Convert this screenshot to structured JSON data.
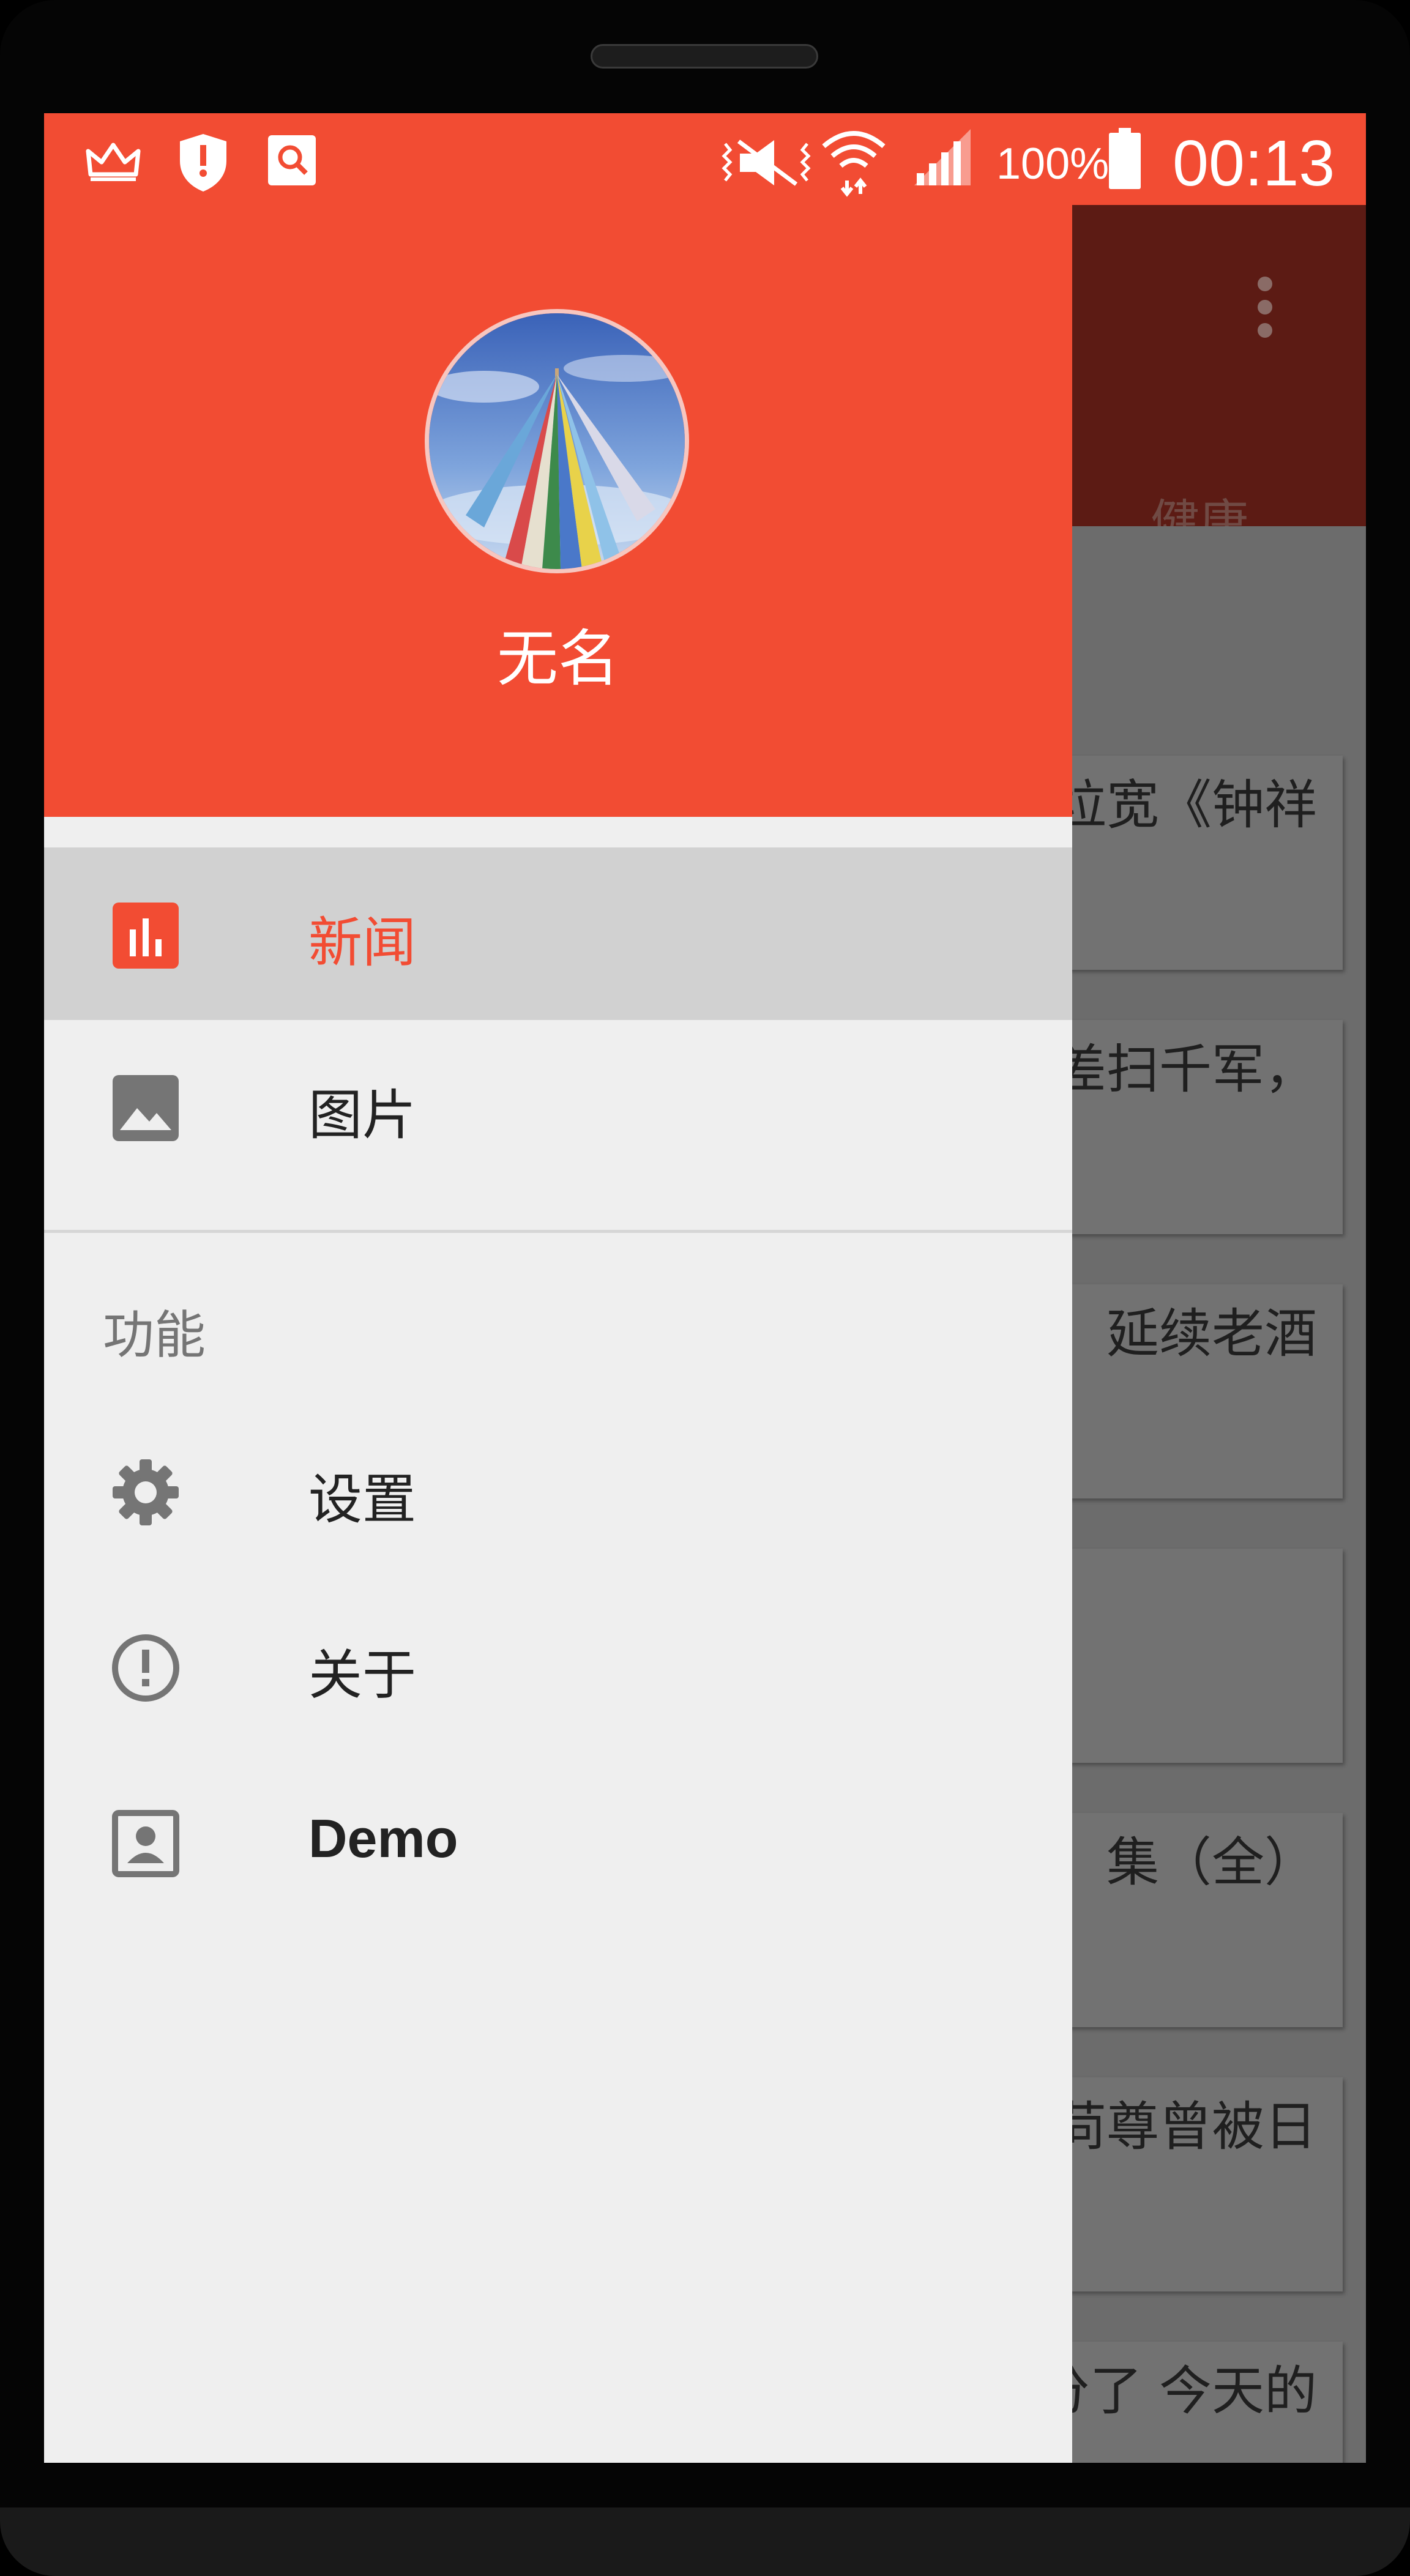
{
  "status_bar": {
    "battery": "100%",
    "time": "00:13",
    "icons": [
      "crown-icon",
      "shield-icon",
      "search-app-icon",
      "vibrate-icon",
      "wifi-icon",
      "signal-icon",
      "battery-icon"
    ]
  },
  "background": {
    "tab": "健康",
    "cards": [
      "垃宽《钟祥",
      "差扫千军，",
      "延续老酒",
      "",
      "集（全）",
      "苘尊曾被日",
      "分了 今天的"
    ]
  },
  "drawer": {
    "user_name": "无名",
    "primary": [
      {
        "label": "新闻",
        "icon": "bar-chart-icon",
        "active": true
      },
      {
        "label": "图片",
        "icon": "image-icon",
        "active": false
      }
    ],
    "section_title": "功能",
    "secondary": [
      {
        "label": "设置",
        "icon": "gear-icon"
      },
      {
        "label": "关于",
        "icon": "info-icon"
      },
      {
        "label": "Demo",
        "icon": "contact-icon"
      }
    ]
  },
  "colors": {
    "accent": "#f24c33",
    "toolbar_dim": "#5c1b14",
    "drawer_bg": "#efefef",
    "active_bg": "#d1d1d1"
  }
}
